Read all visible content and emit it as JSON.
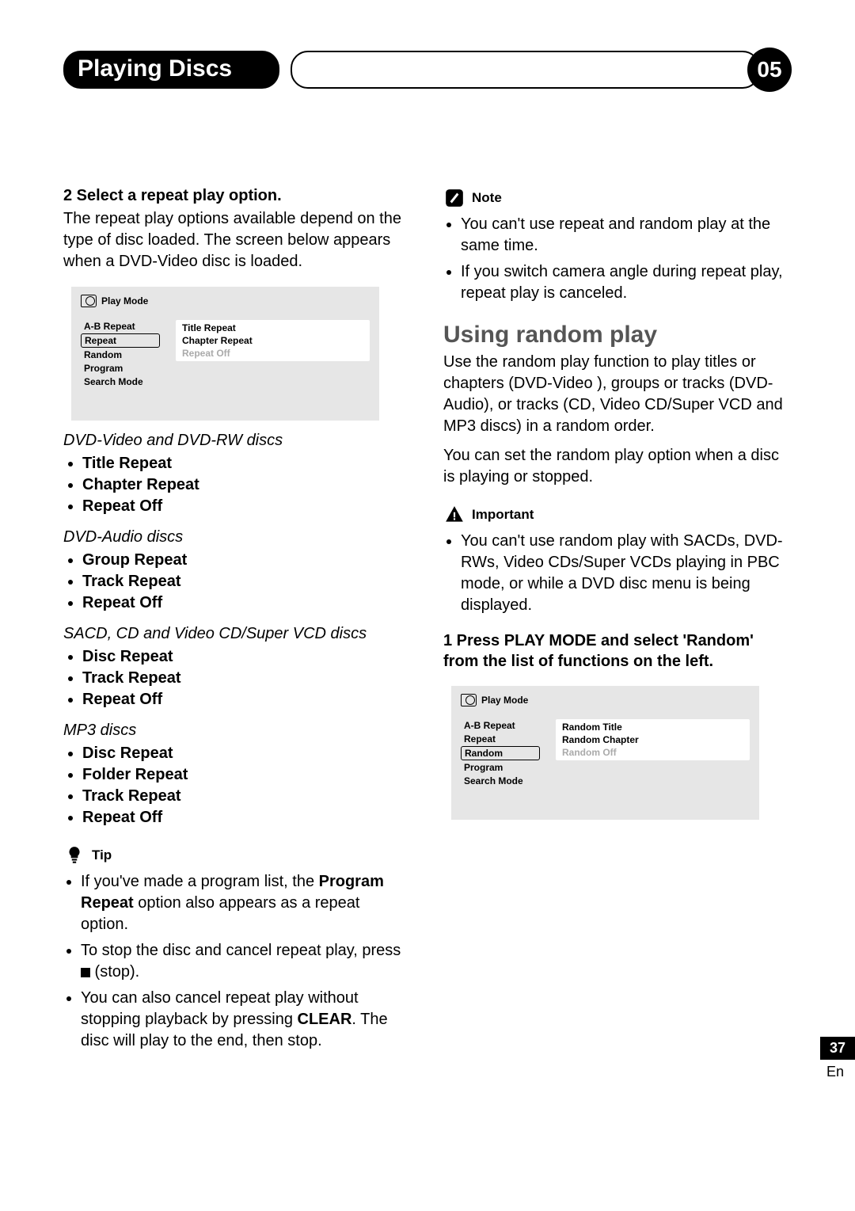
{
  "header": {
    "section_title": "Playing Discs",
    "chapter_number": "05"
  },
  "left": {
    "step2_label": "2   Select a repeat play option.",
    "step2_body": "The repeat play options available depend on the type of disc loaded. The screen below appears when a DVD-Video disc is loaded.",
    "screen1": {
      "title": "Play Mode",
      "left_items": [
        "A-B Repeat",
        "Repeat",
        "Random",
        "Program",
        "Search Mode"
      ],
      "selected_index": 1,
      "right_items": [
        "Title Repeat",
        "Chapter Repeat",
        "Repeat Off"
      ],
      "dim_index": 2
    },
    "groups": [
      {
        "label": "DVD-Video and DVD-RW discs",
        "items": [
          "Title Repeat",
          "Chapter Repeat",
          "Repeat Off"
        ]
      },
      {
        "label": "DVD-Audio discs",
        "items": [
          "Group Repeat",
          "Track Repeat",
          "Repeat Off"
        ]
      },
      {
        "label": "SACD, CD and Video CD/Super VCD discs",
        "items": [
          "Disc Repeat",
          "Track Repeat",
          "Repeat Off"
        ]
      },
      {
        "label": "MP3 discs",
        "items": [
          "Disc Repeat",
          "Folder Repeat",
          "Track Repeat",
          "Repeat Off"
        ]
      }
    ],
    "tip_label": "Tip",
    "tips_html": [
      "If you've made a program list, the <b>Program Repeat</b> option also appears as a repeat option.",
      "To stop the disc and cancel repeat play, press <span class=\"stop-square\"></span> (stop).",
      "You can also cancel repeat play without stopping playback by pressing <b>CLEAR</b>. The disc will play to the end, then stop."
    ]
  },
  "right": {
    "note_label": "Note",
    "notes": [
      "You can't use repeat and random play at the same time.",
      "If you switch camera angle during repeat play, repeat play is canceled."
    ],
    "section_heading": "Using random play",
    "section_para1": "Use the random play function to play titles or chapters (DVD-Video ), groups or tracks (DVD-Audio), or tracks (CD, Video CD/Super VCD and MP3 discs) in a random order.",
    "section_para2": "You can set the random play option when a disc is playing or stopped.",
    "important_label": "Important",
    "important_items": [
      "You can't use random play with SACDs, DVD-RWs, Video CDs/Super VCDs playing in PBC mode, or while  a DVD disc menu is being displayed."
    ],
    "step1_label": "1   Press PLAY MODE and select 'Random' from the list of functions on the left.",
    "screen2": {
      "title": "Play Mode",
      "left_items": [
        "A-B Repeat",
        "Repeat",
        "Random",
        "Program",
        "Search Mode"
      ],
      "selected_index": 2,
      "right_items": [
        "Random Title",
        "Random Chapter",
        "Random Off"
      ],
      "dim_index": 2
    }
  },
  "footer": {
    "page_number": "37",
    "lang": "En"
  }
}
